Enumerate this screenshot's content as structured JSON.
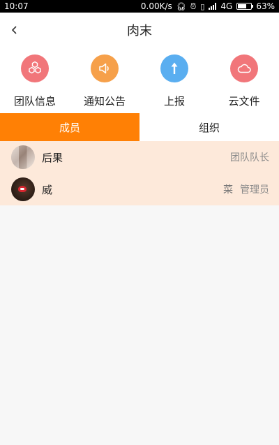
{
  "status_bar": {
    "time": "10:07",
    "speed": "0.00K/s",
    "network": "4G",
    "battery": "63%",
    "battery_level": 63
  },
  "header": {
    "title": "肉末"
  },
  "actions": [
    {
      "label": "团队信息",
      "icon": "hexagon-cluster-icon",
      "color": "#f1767a"
    },
    {
      "label": "通知公告",
      "icon": "speaker-icon",
      "color": "#f6a04a"
    },
    {
      "label": "上报",
      "icon": "arrow-up-icon",
      "color": "#5aaef0"
    },
    {
      "label": "云文件",
      "icon": "cloud-icon",
      "color": "#f1767a"
    }
  ],
  "tabs": [
    {
      "label": "成员",
      "active": true
    },
    {
      "label": "组织",
      "active": false
    }
  ],
  "members": [
    {
      "name": "后果",
      "extra": "",
      "role": "团队队长"
    },
    {
      "name": "威",
      "extra": "菜",
      "role": "管理员"
    }
  ],
  "colors": {
    "accent": "#ff8005",
    "member_bg": "#fde9da",
    "page_bg": "#f7f7f7"
  }
}
